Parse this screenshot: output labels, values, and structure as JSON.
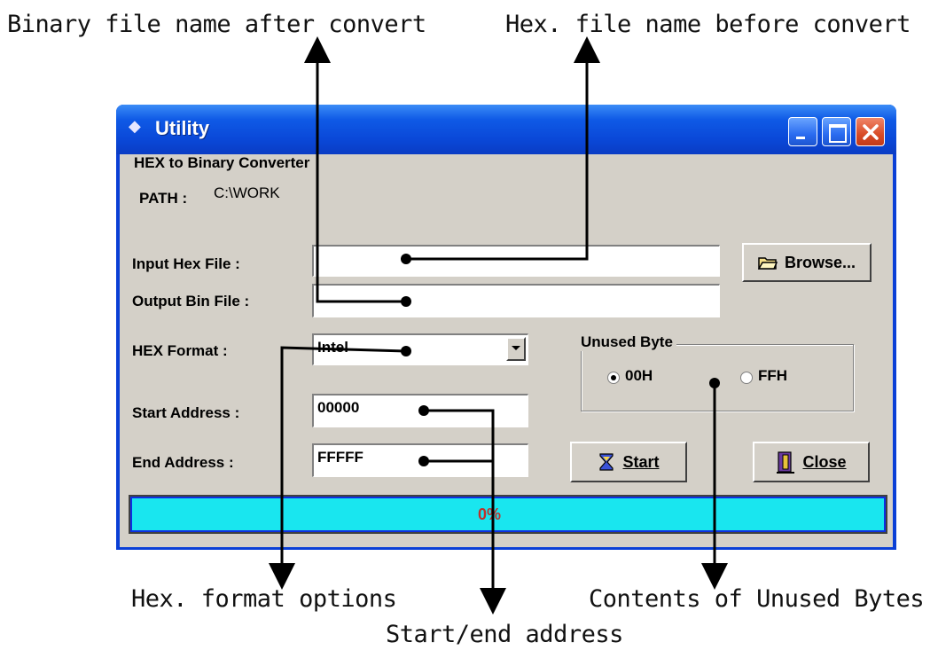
{
  "annotations": {
    "binary_name": "Binary file name after convert",
    "hex_name": "Hex. file name before convert",
    "hex_format": "Hex. format options",
    "unused": "Contents of Unused Bytes",
    "start_end": "Start/end address"
  },
  "window": {
    "title": "Utility",
    "heading": "HEX  to Binary Converter",
    "path_label": "PATH :",
    "path_value": "C:\\WORK"
  },
  "form": {
    "input_hex_label": "Input Hex File :",
    "input_hex_value": "",
    "output_bin_label": "Output Bin File :",
    "output_bin_value": "",
    "hex_format_label": "HEX Format  :",
    "hex_format_value": "Intel",
    "start_label": "Start Address :",
    "start_value": "00000",
    "end_label": "End Address  :",
    "end_value": "FFFFF"
  },
  "buttons": {
    "browse": "Browse...",
    "start": "Start",
    "close": "Close"
  },
  "unused_byte": {
    "title": "Unused Byte",
    "options": [
      "00H",
      "FFH"
    ],
    "selected": "00H"
  },
  "progress": {
    "text": "0%",
    "value": 0
  },
  "colors": {
    "titlebar": "#0a48d8",
    "client": "#d4d0c8",
    "progress_fill": "#19e6ef",
    "progress_text": "#c0302a"
  }
}
